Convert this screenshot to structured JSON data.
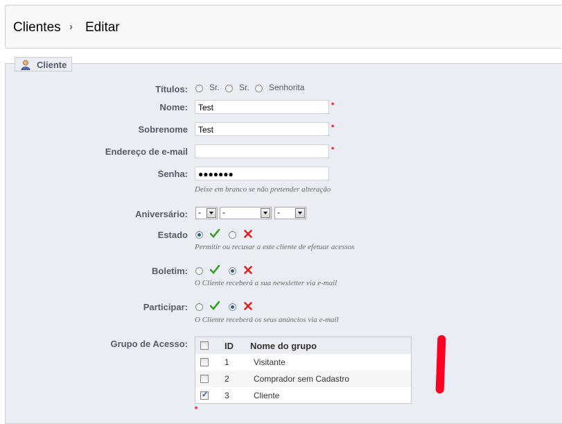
{
  "breadcrumb": {
    "section": "Clientes",
    "page": "Editar"
  },
  "fieldset": {
    "legend": "Cliente"
  },
  "form": {
    "titles": {
      "label": "Títulos:",
      "options": [
        "Sr.",
        "Sr.",
        "Senhorita"
      ]
    },
    "first_name": {
      "label": "Nome:",
      "value": "Test"
    },
    "last_name": {
      "label": "Sobrenome",
      "value": "Test"
    },
    "email": {
      "label": "Endereço de e-mail",
      "value": ""
    },
    "password": {
      "label": "Senha:",
      "value": "●●●●●●●",
      "hint": "Deixe em branco se não pretender alteração"
    },
    "birthday": {
      "label": "Aniversário:",
      "day": "-",
      "month": "-",
      "year": "-"
    },
    "status": {
      "label": "Estado",
      "hint": "Permitir ou recusar a este cliente de efetuar acessos",
      "selected": "yes"
    },
    "newsletter": {
      "label": "Boletim:",
      "hint": "O Cliente receberá a sua newsletter via e-mail",
      "selected": "no"
    },
    "optin": {
      "label": "Participar:",
      "hint": "O Cliente receberá os seus anúncios via e-mail",
      "selected": "no"
    },
    "groups": {
      "label": "Grupo de Acesso:",
      "headers": {
        "id": "ID",
        "name": "Nome do grupo"
      },
      "rows": [
        {
          "id": "1",
          "name": "Visitante",
          "checked": false
        },
        {
          "id": "2",
          "name": "Comprador sem Cadastro",
          "checked": false
        },
        {
          "id": "3",
          "name": "Cliente",
          "checked": true
        }
      ]
    },
    "required_mark": "*"
  },
  "colors": {
    "required": "#ff0000",
    "check_green": "#3a9d23",
    "x_red": "#e02020",
    "annotation": "#ff0022"
  }
}
